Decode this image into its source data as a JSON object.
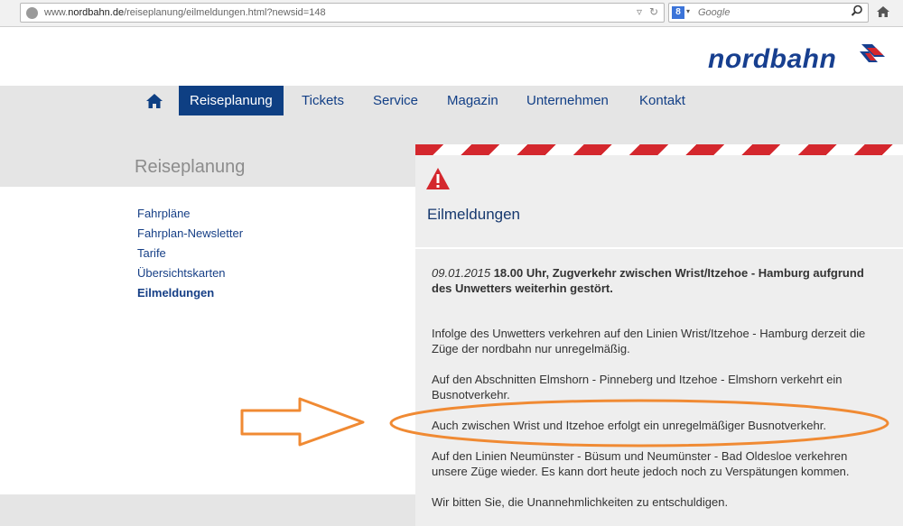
{
  "browser": {
    "url_prefix": "www.",
    "url_domain": "nordbahn.de",
    "url_path": "/reiseplanung/eilmeldungen.html?newsid=148",
    "search_engine": "8",
    "search_placeholder": "Google"
  },
  "site": {
    "logo_text": "nordbahn",
    "brand_color": "#173f8f"
  },
  "nav": {
    "home_icon": "home-icon",
    "items": [
      "Reiseplanung",
      "Tickets",
      "Service",
      "Magazin",
      "Unternehmen",
      "Kontakt"
    ],
    "active": "Reiseplanung"
  },
  "section": {
    "title": "Reiseplanung"
  },
  "sidebar": {
    "items": [
      "Fahrpläne",
      "Fahrplan-Newsletter",
      "Tarife",
      "Übersichtskarten",
      "Eilmeldungen"
    ],
    "current": "Eilmeldungen"
  },
  "panel": {
    "title": "Eilmeldungen",
    "stripe_colors": [
      "#d4272d",
      "#ffffff"
    ],
    "headline_date": "09.01.2015",
    "headline_text": " 18.00 Uhr, Zugverkehr zwischen Wrist/Itzehoe - Hamburg aufgrund des Unwetters weiterhin gestört.",
    "paragraphs": [
      "Infolge des Unwetters verkehren auf den Linien Wrist/Itzehoe - Hamburg derzeit die Züge der nordbahn nur unregelmäßig.",
      "Auf den Abschnitten Elmshorn - Pinneberg und Itzehoe - Elmshorn verkehrt ein Busnotverkehr.",
      "Auch zwischen Wrist und Itzehoe erfolgt ein unregelmäßiger Busnotverkehr.",
      "Auf den Linien Neumünster - Büsum und Neumünster - Bad Oldesloe verkehren unsere Züge wieder. Es kann dort heute jedoch noch zu Verspätungen kommen.",
      "Wir bitten Sie, die Unannehmlichkeiten zu entschuldigen."
    ]
  },
  "annotation_color": "#f08a33"
}
